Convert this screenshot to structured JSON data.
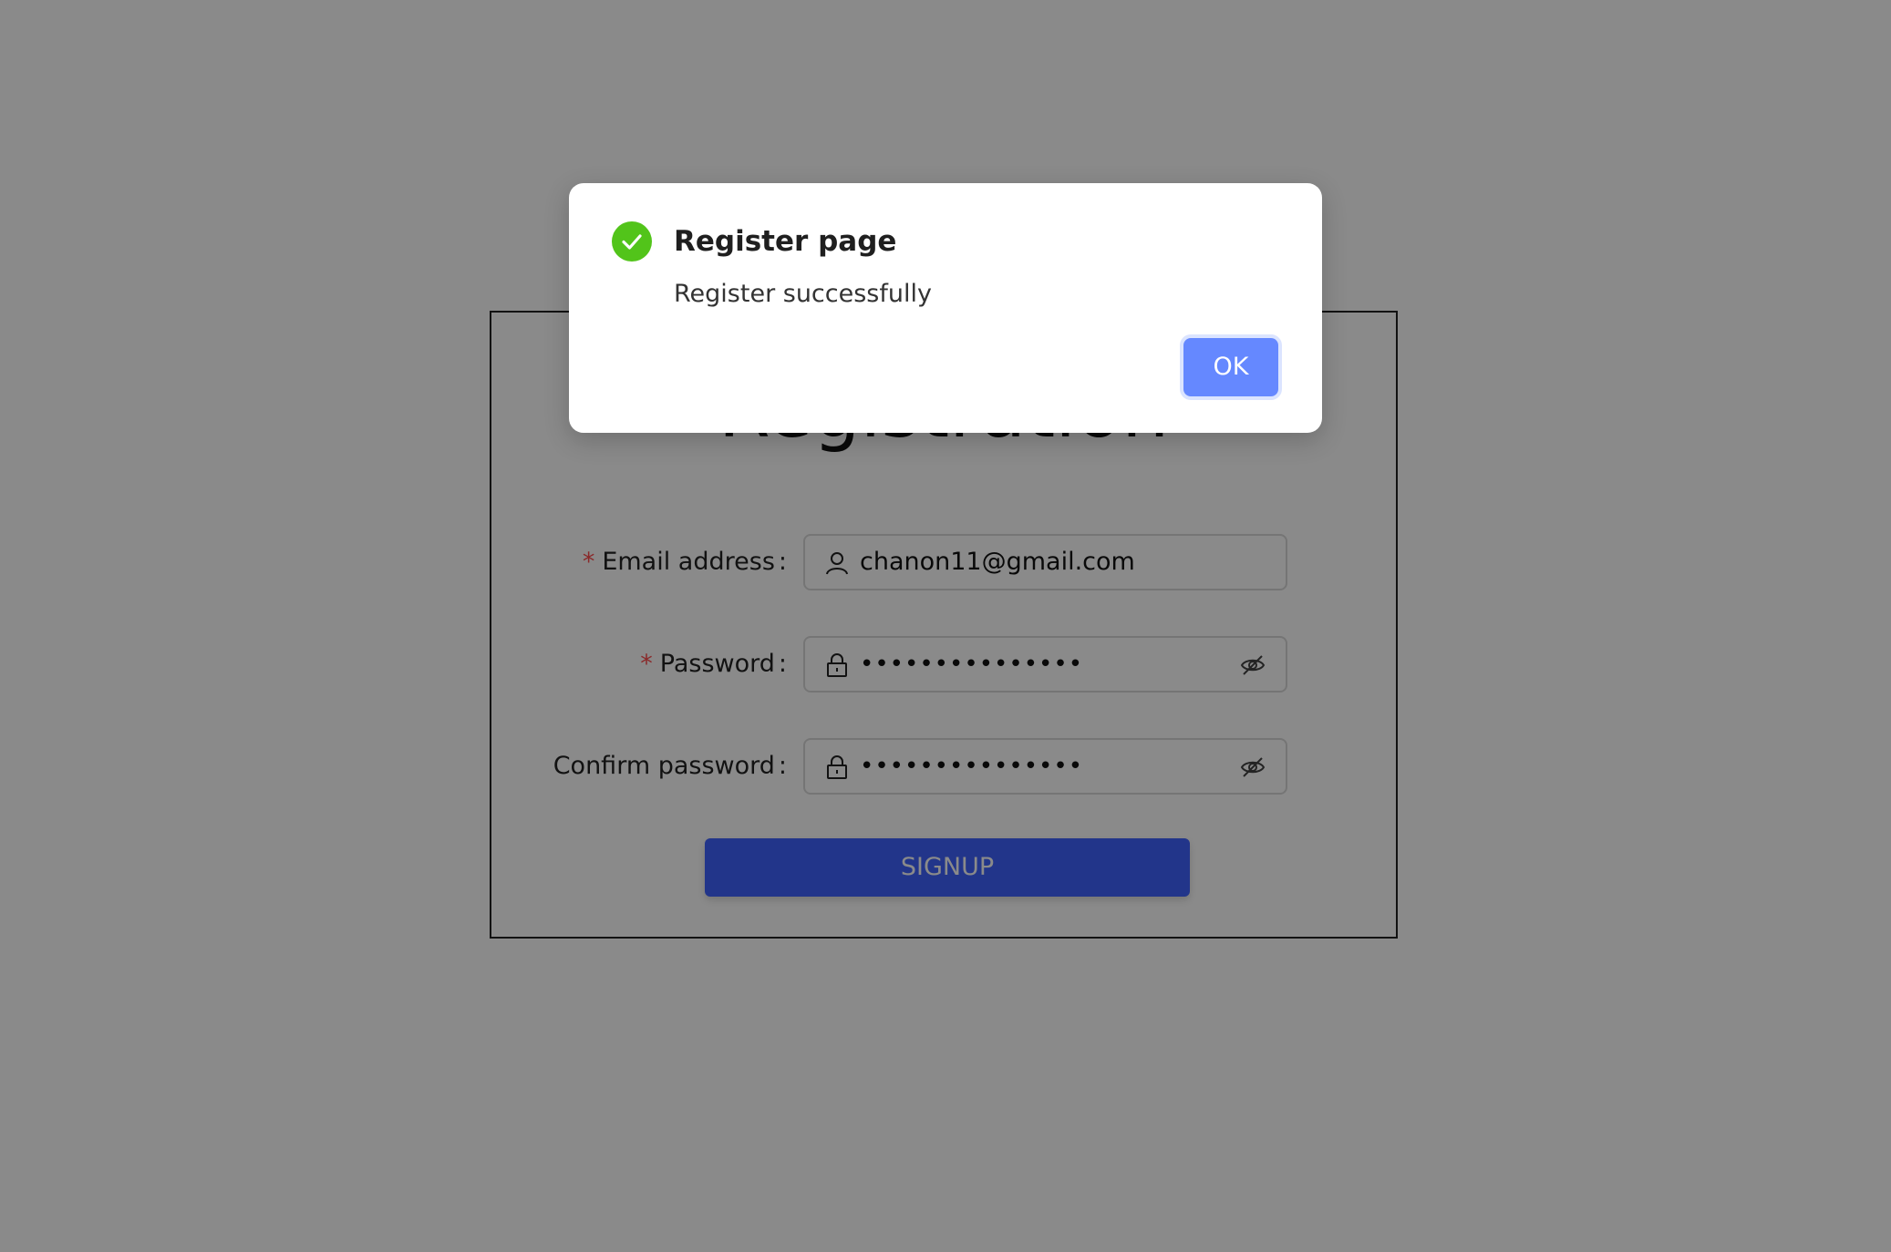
{
  "registration": {
    "title": "Registration",
    "fields": [
      {
        "label": "Email address",
        "required": "*",
        "value": "chanon11@gmail.com",
        "icon": "user-icon"
      },
      {
        "label": "Password",
        "required": "*",
        "value": "•••••••••••••••",
        "icon": "lock-icon",
        "toggle_icon": "eye-invisible-icon"
      },
      {
        "label": "Confirm password",
        "required": "",
        "value": "•••••••••••••••",
        "icon": "lock-icon",
        "toggle_icon": "eye-invisible-icon"
      }
    ],
    "colon": ":",
    "signup_label": "SIGNUP"
  },
  "modal": {
    "title": "Register page",
    "content": "Register successfully",
    "ok_label": "OK",
    "icon": "check-circle-icon"
  },
  "colors": {
    "primary": "#3f63ff",
    "success": "#52c41a",
    "required": "#ff4d4f",
    "mask": "rgba(0,0,0,0.46)"
  }
}
